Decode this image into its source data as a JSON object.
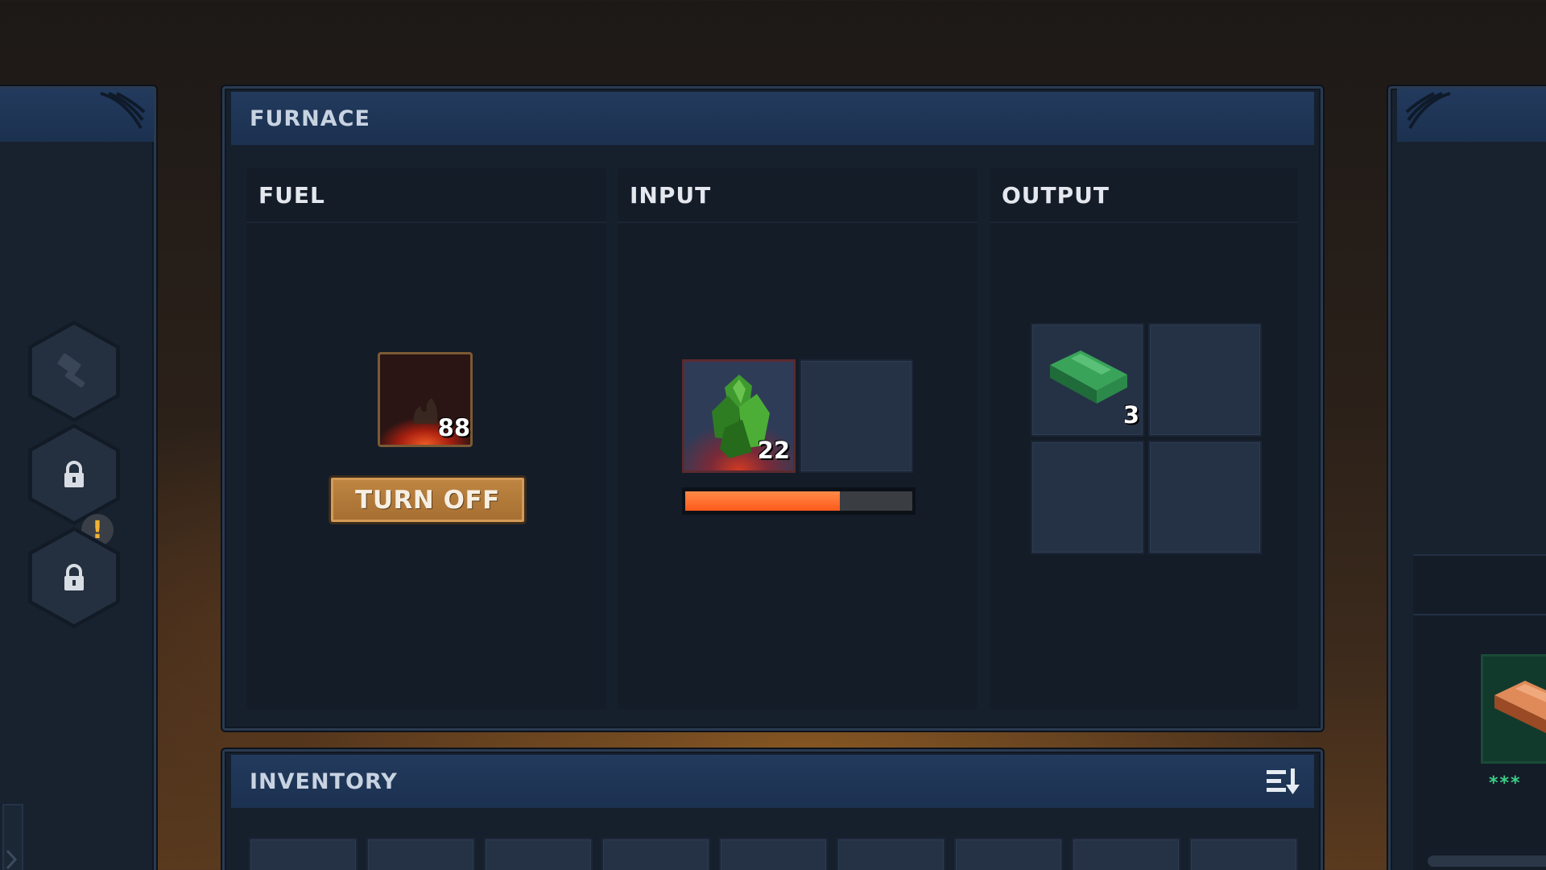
{
  "furnace": {
    "title": "FURNACE",
    "fuel": {
      "title": "FUEL",
      "item_icon": "fire-fuel-icon",
      "quantity": "88",
      "toggle_label": "TURN OFF"
    },
    "input": {
      "title": "INPUT",
      "item_icon": "green-ore-icon",
      "quantity": "22",
      "smelt_progress": 0.68,
      "progress_color": "#ff6a2b"
    },
    "output": {
      "title": "OUTPUT",
      "item_icon": "green-ingot-icon",
      "quantity": "3"
    }
  },
  "inventory": {
    "title": "INVENTORY",
    "sort_icon": "sort-icon"
  },
  "left_sidebar": {
    "buttons": [
      {
        "icon": "hammer-icon",
        "locked": false
      },
      {
        "icon": "lock-icon",
        "locked": true,
        "alert": "!"
      },
      {
        "icon": "lock-icon",
        "locked": true
      }
    ]
  },
  "right_panel": {
    "item_icon": "copper-ingot-icon",
    "rating_text": "***"
  },
  "colors": {
    "accent_header": "#1e3455",
    "fuel_slot_glow": "#e8401c",
    "alert_badge": "#f2b233"
  }
}
